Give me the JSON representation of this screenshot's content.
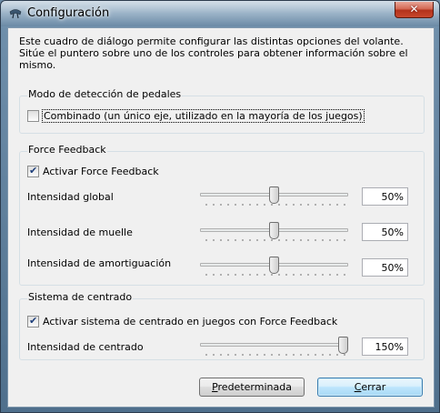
{
  "window": {
    "title": "Configuración",
    "close_glyph": "✕"
  },
  "intro_text": "Este cuadro de diálogo permite configurar las distintas opciones del volante. Sitúe el puntero sobre uno de los controles para obtener información sobre el mismo.",
  "pedals": {
    "group_title": "Modo de detección de pedales",
    "combined_label": "Combinado (un único eje, utilizado en la mayoría de los juegos)",
    "combined_checked": false
  },
  "force_feedback": {
    "group_title": "Force Feedback",
    "enable_label": "Activar Force Feedback",
    "enable_checked": true,
    "sliders": [
      {
        "label": "Intensidad global",
        "value_text": "50%",
        "value": 0.5
      },
      {
        "label": "Intensidad de muelle",
        "value_text": "50%",
        "value": 0.5
      },
      {
        "label": "Intensidad de amortiguación",
        "value_text": "50%",
        "value": 0.5
      }
    ]
  },
  "centering": {
    "group_title": "Sistema de centrado",
    "enable_label": "Activar sistema de centrado en juegos con Force Feedback",
    "enable_checked": true,
    "slider": {
      "label": "Intensidad de centrado",
      "value_text": "150%",
      "value": 1.0
    }
  },
  "buttons": {
    "default_label": "Predeterminada",
    "close_label": "Cerrar"
  }
}
